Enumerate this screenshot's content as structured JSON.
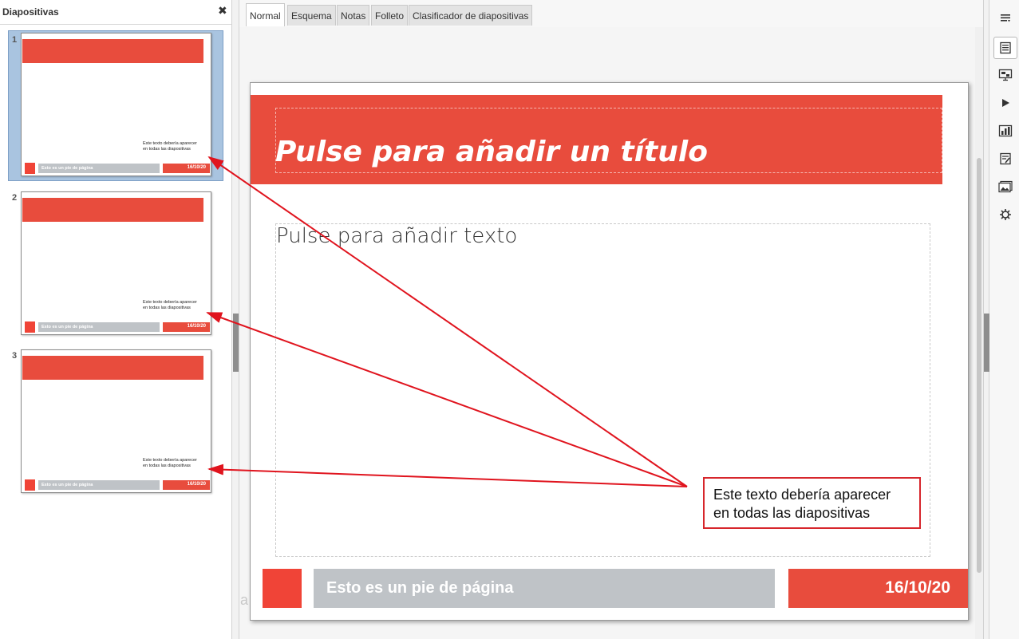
{
  "slides_panel": {
    "title": "Diapositivas",
    "close_glyph": "✖",
    "thumbnails": [
      {
        "number": "1",
        "text_line1": "Este texto debería aparecer",
        "text_line2": "en todas las diapositivas",
        "footer": "Esto es un pie de página",
        "date": "16/10/20",
        "selected": true
      },
      {
        "number": "2",
        "text_line1": "Este texto debería aparecer",
        "text_line2": "en todas las diapositivas",
        "footer": "Esto es un pie de página",
        "date": "16/10/20",
        "selected": false
      },
      {
        "number": "3",
        "text_line1": "Este texto debería aparecer",
        "text_line2": "en todas las diapositivas",
        "footer": "Esto es un pie de página",
        "date": "16/10/20",
        "selected": false
      }
    ]
  },
  "view_tabs": [
    {
      "label": "Normal",
      "active": true
    },
    {
      "label": "Esquema",
      "active": false
    },
    {
      "label": "Notas",
      "active": false
    },
    {
      "label": "Folleto",
      "active": false
    },
    {
      "label": "Clasificador de diapositivas",
      "active": false
    }
  ],
  "slide": {
    "title_placeholder": "Pulse para añadir un título",
    "body_placeholder": "Pulse para añadir texto",
    "annotation_line1": "Este texto debería aparecer",
    "annotation_line2": "en todas las diapositivas",
    "footer": "Esto es un pie de página",
    "date": "16/10/20"
  },
  "ghost_char": "a",
  "sidebar": {
    "icons": [
      "menu-icon",
      "properties-icon",
      "slide-transition-icon",
      "animation-icon",
      "master-slides-icon",
      "styles-icon",
      "gallery-icon",
      "navigator-icon"
    ]
  },
  "colors": {
    "accent": "#e84c3d",
    "footer_gray": "#bfc3c7",
    "annotation_red": "#d7262c",
    "selection": "#a9c4e0"
  }
}
